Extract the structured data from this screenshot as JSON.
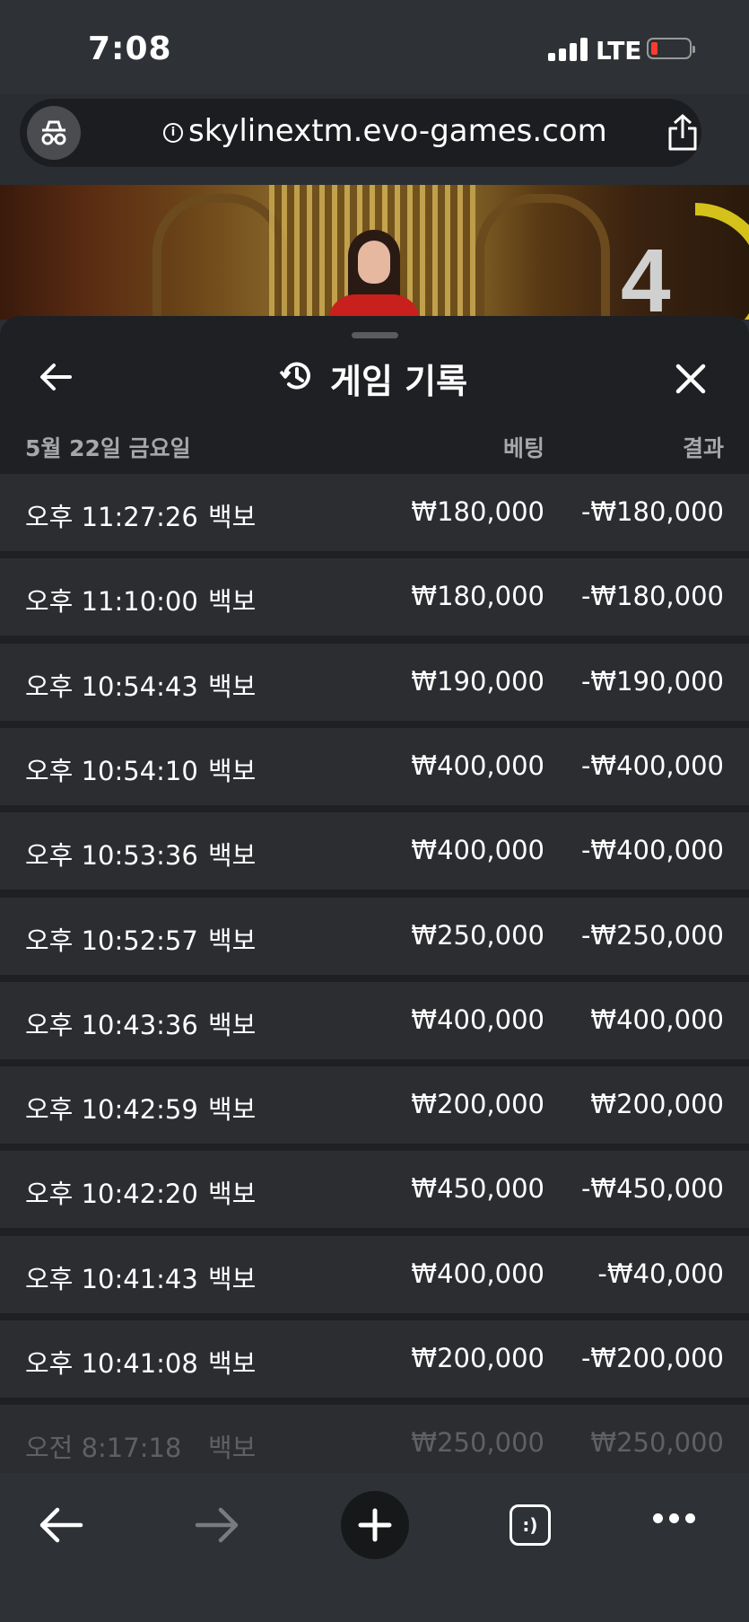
{
  "status_bar": {
    "time": "7:08",
    "network": "LTE"
  },
  "browser": {
    "url": "skylinextm.evo-games.com"
  },
  "video": {
    "timer": "4"
  },
  "sheet": {
    "title": "게임 기록",
    "date": "5월 22일 금요일",
    "col_bet": "베팅",
    "col_result": "결과",
    "rows": [
      {
        "time": "오후 11:27:26",
        "game": "백보",
        "bet": "₩180,000",
        "result": "-₩180,000"
      },
      {
        "time": "오후 11:10:00",
        "game": "백보",
        "bet": "₩180,000",
        "result": "-₩180,000"
      },
      {
        "time": "오후 10:54:43",
        "game": "백보",
        "bet": "₩190,000",
        "result": "-₩190,000"
      },
      {
        "time": "오후 10:54:10",
        "game": "백보",
        "bet": "₩400,000",
        "result": "-₩400,000"
      },
      {
        "time": "오후 10:53:36",
        "game": "백보",
        "bet": "₩400,000",
        "result": "-₩400,000"
      },
      {
        "time": "오후 10:52:57",
        "game": "백보",
        "bet": "₩250,000",
        "result": "-₩250,000"
      },
      {
        "time": "오후 10:43:36",
        "game": "백보",
        "bet": "₩400,000",
        "result": "₩400,000"
      },
      {
        "time": "오후 10:42:59",
        "game": "백보",
        "bet": "₩200,000",
        "result": "₩200,000"
      },
      {
        "time": "오후 10:42:20",
        "game": "백보",
        "bet": "₩450,000",
        "result": "-₩450,000"
      },
      {
        "time": "오후 10:41:43",
        "game": "백보",
        "bet": "₩400,000",
        "result": "-₩40,000"
      },
      {
        "time": "오후 10:41:08",
        "game": "백보",
        "bet": "₩200,000",
        "result": "-₩200,000"
      },
      {
        "time": "오전 8:17:18",
        "game": "백보",
        "bet": "₩250,000",
        "result": "₩250,000"
      }
    ]
  },
  "toolbar": {
    "tabs_label": ":)"
  },
  "colors": {
    "battery_low": "#ff3b30",
    "timer_ring": "#d4c21a",
    "row_bg": "#2c2d31",
    "sheet_bg": "#1f2023"
  }
}
